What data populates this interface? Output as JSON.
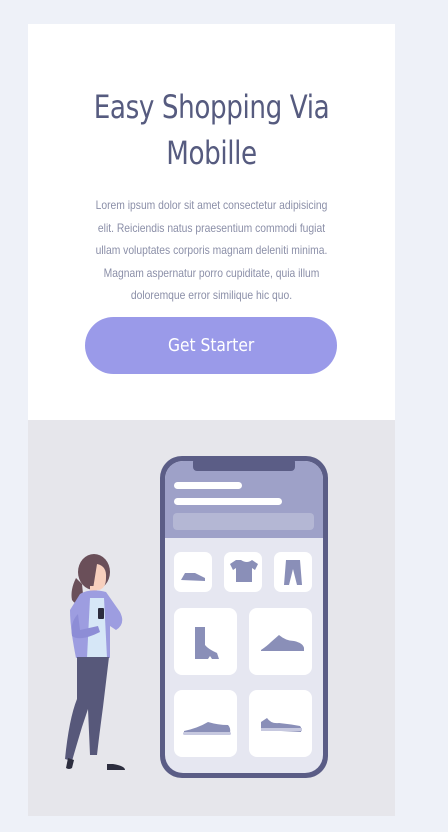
{
  "hero": {
    "title": "Easy Shopping Via Mobille",
    "description": "Lorem ipsum dolor sit amet consectetur adipisicing elit. Reiciendis natus praesentium commodi fugiat ullam voluptates corporis magnam deleniti minima. Magnam aspernatur porro cupiditate, quia illum doloremque error similique hic quo.",
    "cta_label": "Get Starter"
  },
  "colors": {
    "page_bg": "#eef1f8",
    "title": "#565b7f",
    "cta_bg": "#9a9ae9",
    "phone_frame": "#5b5d86",
    "phone_header": "#9ea1c8",
    "product_icon": "#8a8fb8"
  },
  "illustration": {
    "products": [
      "slipper-icon",
      "tshirt-icon",
      "pants-icon",
      "boot-icon",
      "sneaker-icon",
      "running-shoe-icon",
      "low-shoe-icon"
    ]
  }
}
